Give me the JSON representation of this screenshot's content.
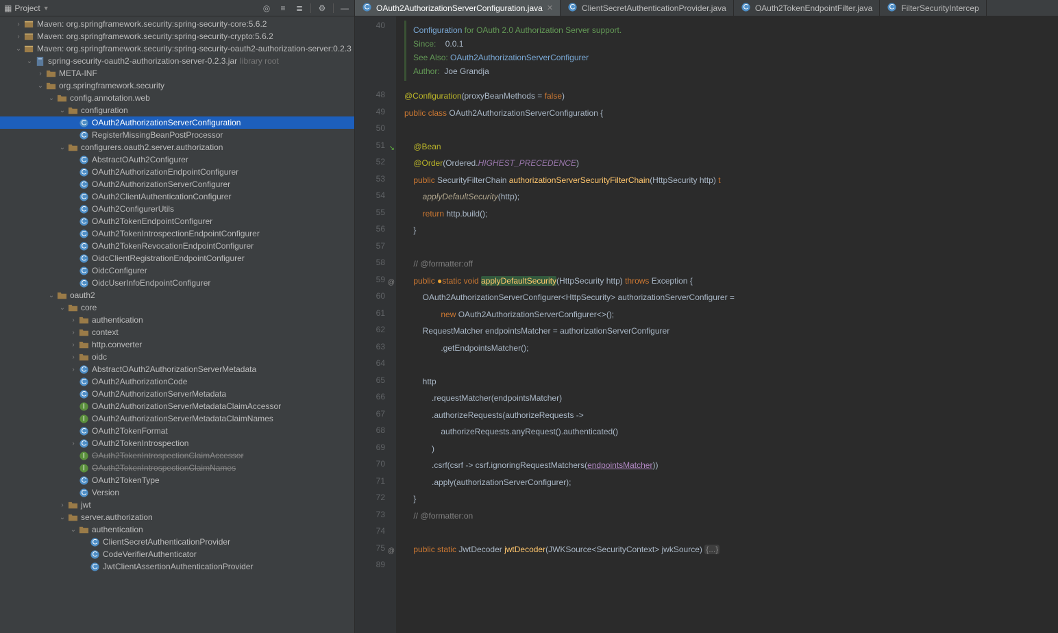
{
  "sidebar": {
    "title": "Project",
    "actions": [
      "select-opened",
      "expand-all",
      "collapse-all",
      "divider",
      "settings",
      "divider",
      "hide"
    ],
    "tree": [
      {
        "d": 1,
        "exp": ">",
        "icon": "jar",
        "text": "Maven: org.springframework.security:spring-security-core:5.6.2"
      },
      {
        "d": 1,
        "exp": ">",
        "icon": "jar",
        "text": "Maven: org.springframework.security:spring-security-crypto:5.6.2"
      },
      {
        "d": 1,
        "exp": "v",
        "icon": "jar",
        "text": "Maven: org.springframework.security:spring-security-oauth2-authorization-server:0.2.3"
      },
      {
        "d": 2,
        "exp": "v",
        "icon": "jarfile",
        "text": "spring-security-oauth2-authorization-server-0.2.3.jar",
        "suffix": "library root"
      },
      {
        "d": 3,
        "exp": ">",
        "icon": "folder",
        "text": "META-INF"
      },
      {
        "d": 3,
        "exp": "v",
        "icon": "folder",
        "text": "org.springframework.security"
      },
      {
        "d": 4,
        "exp": "v",
        "icon": "pkg",
        "text": "config.annotation.web"
      },
      {
        "d": 5,
        "exp": "v",
        "icon": "pkg",
        "text": "configuration"
      },
      {
        "d": 6,
        "exp": "",
        "icon": "class",
        "text": "OAuth2AuthorizationServerConfiguration",
        "sel": true
      },
      {
        "d": 6,
        "exp": "",
        "icon": "class",
        "text": "RegisterMissingBeanPostProcessor"
      },
      {
        "d": 5,
        "exp": "v",
        "icon": "pkg",
        "text": "configurers.oauth2.server.authorization"
      },
      {
        "d": 6,
        "exp": "",
        "icon": "class",
        "text": "AbstractOAuth2Configurer"
      },
      {
        "d": 6,
        "exp": "",
        "icon": "class",
        "text": "OAuth2AuthorizationEndpointConfigurer"
      },
      {
        "d": 6,
        "exp": "",
        "icon": "class",
        "text": "OAuth2AuthorizationServerConfigurer"
      },
      {
        "d": 6,
        "exp": "",
        "icon": "class",
        "text": "OAuth2ClientAuthenticationConfigurer"
      },
      {
        "d": 6,
        "exp": "",
        "icon": "class",
        "text": "OAuth2ConfigurerUtils"
      },
      {
        "d": 6,
        "exp": "",
        "icon": "class",
        "text": "OAuth2TokenEndpointConfigurer"
      },
      {
        "d": 6,
        "exp": "",
        "icon": "class",
        "text": "OAuth2TokenIntrospectionEndpointConfigurer"
      },
      {
        "d": 6,
        "exp": "",
        "icon": "class",
        "text": "OAuth2TokenRevocationEndpointConfigurer"
      },
      {
        "d": 6,
        "exp": "",
        "icon": "class",
        "text": "OidcClientRegistrationEndpointConfigurer"
      },
      {
        "d": 6,
        "exp": "",
        "icon": "class",
        "text": "OidcConfigurer"
      },
      {
        "d": 6,
        "exp": "",
        "icon": "class",
        "text": "OidcUserInfoEndpointConfigurer"
      },
      {
        "d": 4,
        "exp": "v",
        "icon": "pkg",
        "text": "oauth2"
      },
      {
        "d": 5,
        "exp": "v",
        "icon": "pkg",
        "text": "core"
      },
      {
        "d": 6,
        "exp": ">",
        "icon": "pkg",
        "text": "authentication"
      },
      {
        "d": 6,
        "exp": ">",
        "icon": "pkg",
        "text": "context"
      },
      {
        "d": 6,
        "exp": ">",
        "icon": "pkg",
        "text": "http.converter"
      },
      {
        "d": 6,
        "exp": ">",
        "icon": "pkg",
        "text": "oidc"
      },
      {
        "d": 6,
        "exp": ">",
        "icon": "class",
        "text": "AbstractOAuth2AuthorizationServerMetadata"
      },
      {
        "d": 6,
        "exp": "",
        "icon": "class",
        "text": "OAuth2AuthorizationCode"
      },
      {
        "d": 6,
        "exp": "",
        "icon": "class",
        "text": "OAuth2AuthorizationServerMetadata"
      },
      {
        "d": 6,
        "exp": "",
        "icon": "interface",
        "text": "OAuth2AuthorizationServerMetadataClaimAccessor"
      },
      {
        "d": 6,
        "exp": "",
        "icon": "interface",
        "text": "OAuth2AuthorizationServerMetadataClaimNames"
      },
      {
        "d": 6,
        "exp": "",
        "icon": "class",
        "text": "OAuth2TokenFormat"
      },
      {
        "d": 6,
        "exp": ">",
        "icon": "class",
        "text": "OAuth2TokenIntrospection"
      },
      {
        "d": 6,
        "exp": "",
        "icon": "interface",
        "text": "OAuth2TokenIntrospectionClaimAccessor",
        "strike": true
      },
      {
        "d": 6,
        "exp": "",
        "icon": "interface",
        "text": "OAuth2TokenIntrospectionClaimNames",
        "strike": true
      },
      {
        "d": 6,
        "exp": "",
        "icon": "class",
        "text": "OAuth2TokenType"
      },
      {
        "d": 6,
        "exp": "",
        "icon": "class",
        "text": "Version"
      },
      {
        "d": 5,
        "exp": ">",
        "icon": "pkg",
        "text": "jwt"
      },
      {
        "d": 5,
        "exp": "v",
        "icon": "pkg",
        "text": "server.authorization"
      },
      {
        "d": 6,
        "exp": "v",
        "icon": "pkg",
        "text": "authentication"
      },
      {
        "d": 7,
        "exp": "",
        "icon": "class",
        "text": "ClientSecretAuthenticationProvider"
      },
      {
        "d": 7,
        "exp": "",
        "icon": "class",
        "text": "CodeVerifierAuthenticator"
      },
      {
        "d": 7,
        "exp": "",
        "icon": "class",
        "text": "JwtClientAssertionAuthenticationProvider"
      }
    ]
  },
  "tabs": [
    {
      "label": "OAuth2AuthorizationServerConfiguration.java",
      "active": true
    },
    {
      "label": "ClientSecretAuthenticationProvider.java"
    },
    {
      "label": "OAuth2TokenEndpointFilter.java"
    },
    {
      "label": "FilterSecurityIntercep"
    }
  ],
  "doc": {
    "line1a": "Configuration",
    "line1b": " for OAuth 2.0 Authorization Server support.",
    "since_l": "Since:",
    "since_v": "0.0.1",
    "see_l": "See Also:",
    "see_v": "OAuth2AuthorizationServerConfigurer",
    "auth_l": "Author:",
    "auth_v": "Joe Grandja"
  },
  "editor": {
    "first_line": 40,
    "lines": [
      {
        "n": 48,
        "html": "<span class='tk-ann'>@Configuration</span>(proxyBeanMethods = <span class='tk-kw'>false</span>)"
      },
      {
        "n": 49,
        "html": "<span class='tk-kw'>public class</span> OAuth2AuthorizationServerConfiguration {"
      },
      {
        "n": 50,
        "html": ""
      },
      {
        "n": 51,
        "html": "    <span class='tk-ann'>@Bean</span>",
        "mark": "impl"
      },
      {
        "n": 52,
        "html": "    <span class='tk-ann'>@Order</span>(Ordered.<span class='tk-const'>HIGHEST_PRECEDENCE</span>)"
      },
      {
        "n": 53,
        "html": "    <span class='tk-kw'>public</span> SecurityFilterChain <span class='tk-mtd'>authorizationServerSecurityFilterChain</span>(HttpSecurity http) <span class='tk-kw'>t</span>"
      },
      {
        "n": 54,
        "html": "        <span class='tk-mtdi'>applyDefaultSecurity</span>(http);"
      },
      {
        "n": 55,
        "html": "        <span class='tk-kw'>return</span> http.build();"
      },
      {
        "n": 56,
        "html": "    }"
      },
      {
        "n": 57,
        "html": ""
      },
      {
        "n": 58,
        "html": "    <span class='tk-com'>// @formatter:off</span>"
      },
      {
        "n": 59,
        "html": "    <span class='tk-kw'>public </span><span style='color:#f0a732'>●</span><span class='tk-kw'>static void</span> <span class='tk-mtd hl'>applyDefaultSecurity</span>(HttpSecurity http) <span class='tk-kw'>throws</span> Exception {",
        "mark": "@"
      },
      {
        "n": 60,
        "html": "        OAuth2AuthorizationServerConfigurer&lt;HttpSecurity&gt; authorizationServerConfigurer ="
      },
      {
        "n": 61,
        "html": "                <span class='tk-kw'>new</span> OAuth2AuthorizationServerConfigurer&lt;&gt;();"
      },
      {
        "n": 62,
        "html": "        RequestMatcher endpointsMatcher = authorizationServerConfigurer"
      },
      {
        "n": 63,
        "html": "                .getEndpointsMatcher();"
      },
      {
        "n": 64,
        "html": ""
      },
      {
        "n": 65,
        "html": "        http"
      },
      {
        "n": 66,
        "html": "            .requestMatcher(endpointsMatcher)"
      },
      {
        "n": 67,
        "html": "            .authorizeRequests(authorizeRequests -&gt;"
      },
      {
        "n": 68,
        "html": "                authorizeRequests.anyRequest().authenticated()"
      },
      {
        "n": 69,
        "html": "            )"
      },
      {
        "n": 70,
        "html": "            .csrf(csrf -&gt; csrf.ignoringRequestMatchers(<span class='ul' style='color:#b389c5'>endpointsMatcher</span>))"
      },
      {
        "n": 71,
        "html": "            .apply(authorizationServerConfigurer);"
      },
      {
        "n": 72,
        "html": "    }"
      },
      {
        "n": 73,
        "html": "    <span class='tk-com'>// @formatter:on</span>"
      },
      {
        "n": 74,
        "html": ""
      },
      {
        "n": 75,
        "html": "    <span class='tk-kw'>public static</span> JwtDecoder <span class='tk-mtd'>jwtDecoder</span>(JWKSource&lt;SecurityContext&gt; jwkSource) <span class='fold'>{...}</span>",
        "mark": "@"
      },
      {
        "n": 89,
        "html": ""
      }
    ]
  }
}
